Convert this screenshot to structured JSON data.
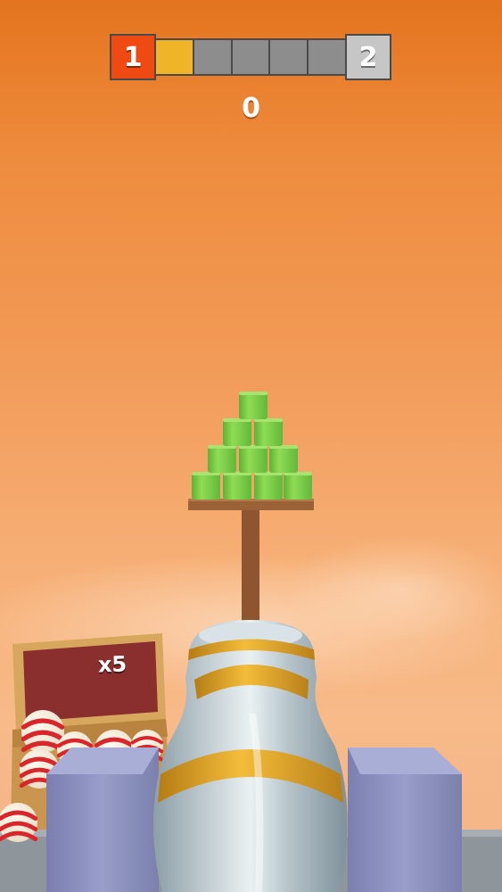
{
  "hud": {
    "current_level": "1",
    "next_level": "2",
    "progress_segments_total": 5,
    "progress_segments_filled": 1,
    "score": "0"
  },
  "ball_crate": {
    "count_label": "x5"
  },
  "colors": {
    "sky_top": "#e4741e",
    "sky_bottom": "#f4b487",
    "level_current": "#ef4a12",
    "level_next": "#c6c6c6",
    "progress_filled": "#f0b428",
    "progress_empty": "#8d8d8d",
    "can_green": "#7ed14a",
    "cannon_body": "#b9c6cc",
    "cannon_band": "#e2a62a",
    "cannon_support": "#8a8fbf",
    "crate_board": "#8a2e2e",
    "ball_red": "#d8262a"
  }
}
